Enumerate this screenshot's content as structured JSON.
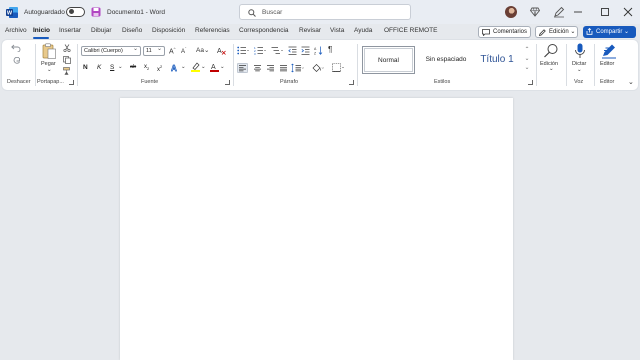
{
  "titlebar": {
    "autosave_label": "Autoguardado",
    "doc_title": "Documento1  -  Word",
    "search_placeholder": "Buscar"
  },
  "tabs": [
    "Archivo",
    "Inicio",
    "Insertar",
    "Dibujar",
    "Diseño",
    "Disposición",
    "Referencias",
    "Correspondencia",
    "Revisar",
    "Vista",
    "Ayuda",
    "OFFICE REMOTE"
  ],
  "active_tab": "Inicio",
  "actions": {
    "comments": "Comentarios",
    "editing": "Edición",
    "share": "Compartir"
  },
  "ribbon": {
    "groups": {
      "undo": "Deshacer",
      "clipboard": "Portapap...",
      "font": "Fuente",
      "paragraph": "Párrafo",
      "styles": "Estilos",
      "voice": "Voz",
      "editor": "Editor"
    },
    "paste_label": "Pegar",
    "font_name": "Calibri (Cuerpo)",
    "font_size": "11",
    "styles": [
      "Normal",
      "Sin espaciado",
      "Título 1"
    ],
    "editing_label": "Edición",
    "dictate_label": "Dictar",
    "editor_label": "Editor"
  },
  "colors": {
    "accent": "#185abd",
    "titlebar_bg": "#e9edf3",
    "canvas_bg": "#e6e9ed",
    "heading_style": "#2f5496",
    "highlight": "#ffff00",
    "font_color": "#c00000"
  }
}
